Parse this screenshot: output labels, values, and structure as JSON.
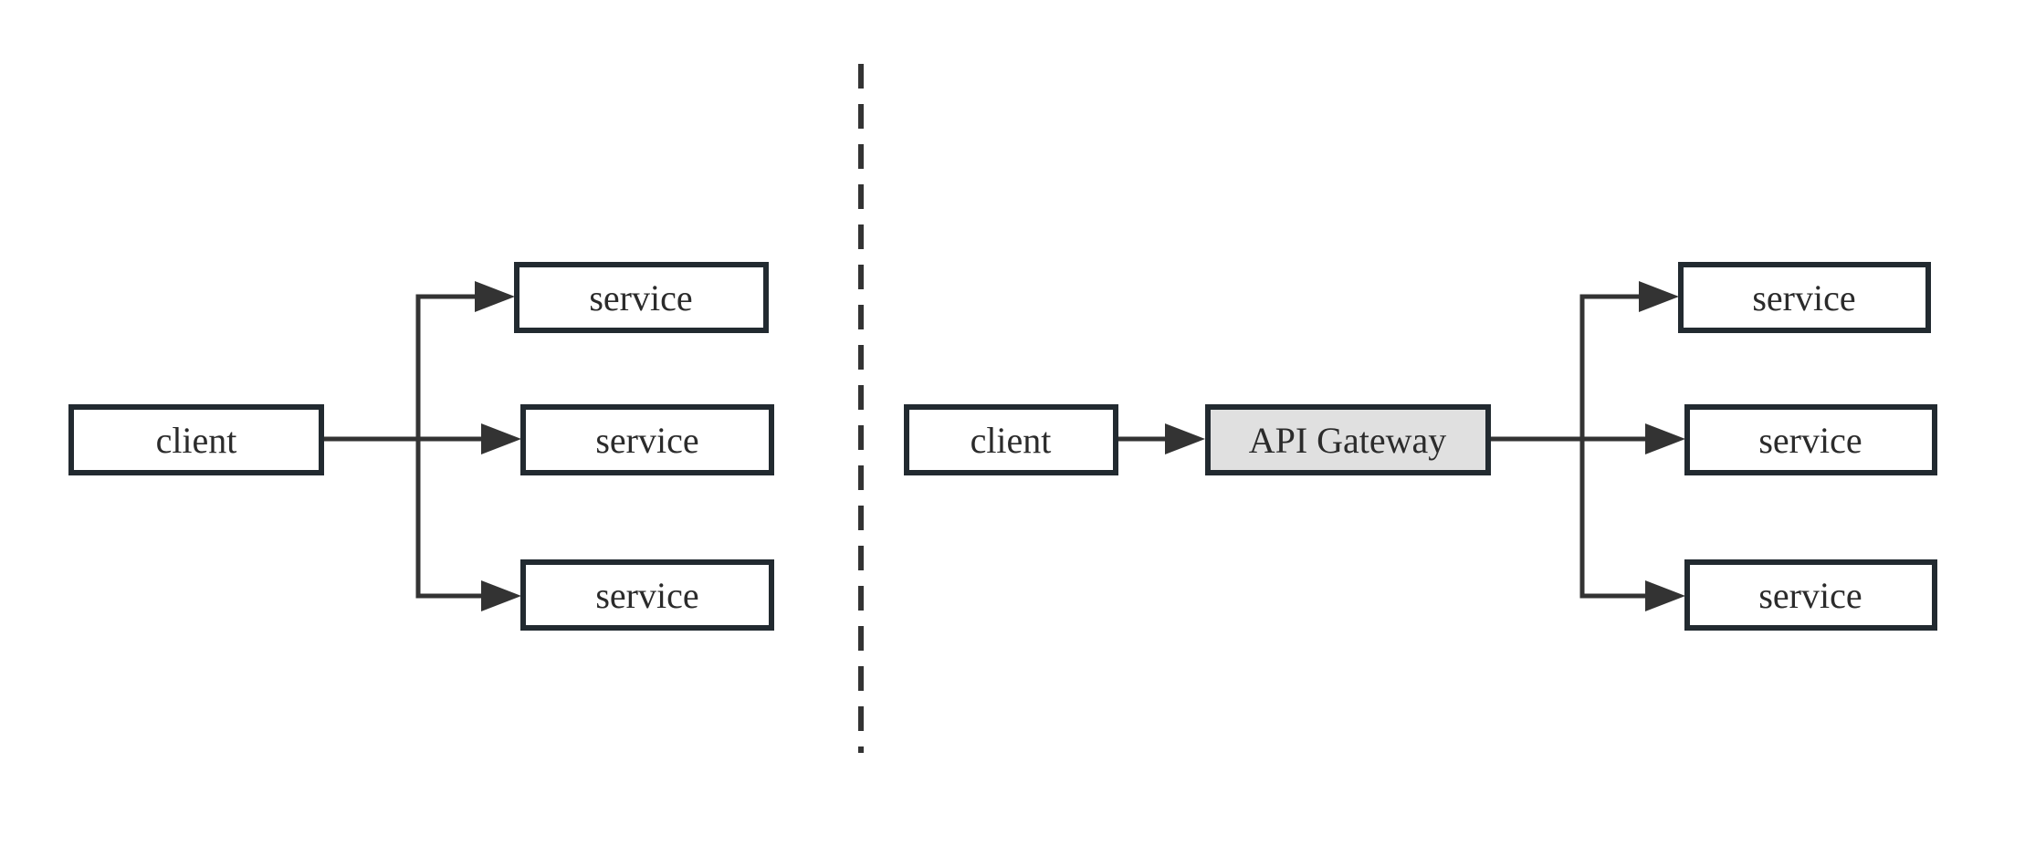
{
  "diagram": {
    "colors": {
      "stroke": "#222a30",
      "edge": "#333333",
      "gateway_fill": "#e0e0e0",
      "node_fill": "#ffffff"
    },
    "left": {
      "client": {
        "label": "client"
      },
      "services": [
        {
          "label": "service"
        },
        {
          "label": "service"
        },
        {
          "label": "service"
        }
      ]
    },
    "divider": {
      "style": "dashed"
    },
    "right": {
      "client": {
        "label": "client"
      },
      "gateway": {
        "label": "API Gateway"
      },
      "services": [
        {
          "label": "service"
        },
        {
          "label": "service"
        },
        {
          "label": "service"
        }
      ]
    }
  }
}
